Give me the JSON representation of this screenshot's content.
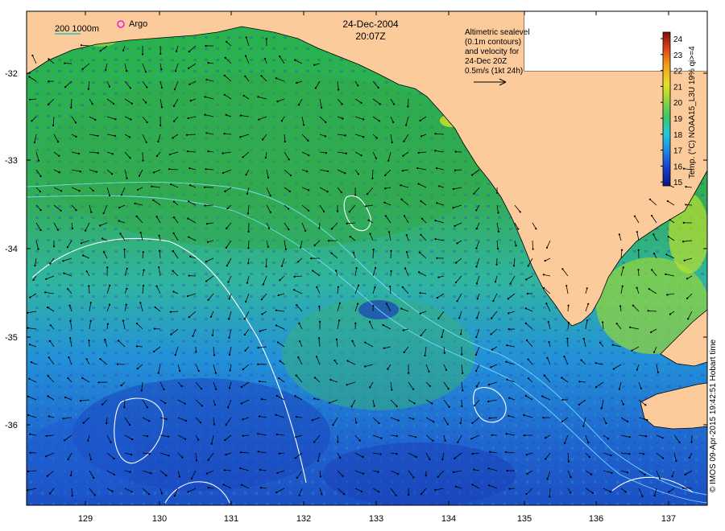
{
  "map": {
    "date": "24-Dec-2004",
    "time": "20:07Z",
    "scale_label": "200 1000m",
    "argo_label": "Argo",
    "legend_lines": [
      "Altimetric sealevel",
      "(0.1m contours)",
      "and velocity for",
      "24-Dec 20Z",
      "0.5m/s (1kt 24h)"
    ],
    "colorbar_title": "Temp. (°C) NOAA15_L3U 19% qi>=4",
    "colorbar_ticks": [
      "15",
      "16",
      "17",
      "18",
      "19",
      "20",
      "21",
      "22",
      "23",
      "24"
    ],
    "lat_ticks": [
      "-32",
      "-33",
      "-34",
      "-35",
      "-36"
    ],
    "lon_ticks": [
      "129",
      "130",
      "131",
      "132",
      "133",
      "134",
      "135",
      "136",
      "137"
    ],
    "credit": "© IMOS 09-Apr-2015 19:42:51 Hobart time",
    "colors": {
      "land": "#fccb9b",
      "sea_warm": "#3fb34f",
      "sea_mid": "#2ec3b8",
      "sea_cool": "#1f78d6",
      "sea_cold": "#1a3fb3",
      "contour": "#ffffff",
      "shelf_line": "#7fe6ff"
    }
  }
}
